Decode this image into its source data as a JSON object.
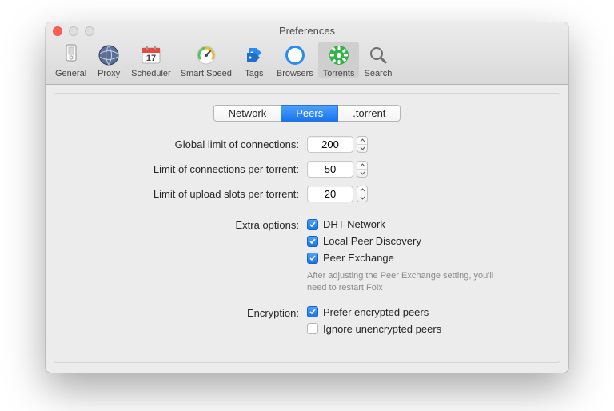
{
  "window": {
    "title": "Preferences"
  },
  "toolbar": {
    "items": [
      {
        "label": "General"
      },
      {
        "label": "Proxy"
      },
      {
        "label": "Scheduler"
      },
      {
        "label": "Smart Speed"
      },
      {
        "label": "Tags"
      },
      {
        "label": "Browsers"
      },
      {
        "label": "Torrents"
      },
      {
        "label": "Search"
      }
    ]
  },
  "tabs": {
    "network": "Network",
    "peers": "Peers",
    "torrent": ".torrent"
  },
  "limits": {
    "global_label": "Global limit of connections:",
    "global_value": "200",
    "pertorrent_label": "Limit of connections per torrent:",
    "pertorrent_value": "50",
    "upload_label": "Limit of upload slots per torrent:",
    "upload_value": "20"
  },
  "extra": {
    "section_label": "Extra options:",
    "dht": "DHT Network",
    "lpd": "Local Peer Discovery",
    "pex": "Peer Exchange",
    "pex_hint": "After adjusting the Peer Exchange setting, you'll need to restart Folx"
  },
  "encryption": {
    "section_label": "Encryption:",
    "prefer": "Prefer encrypted peers",
    "ignore": "Ignore unencrypted peers"
  }
}
